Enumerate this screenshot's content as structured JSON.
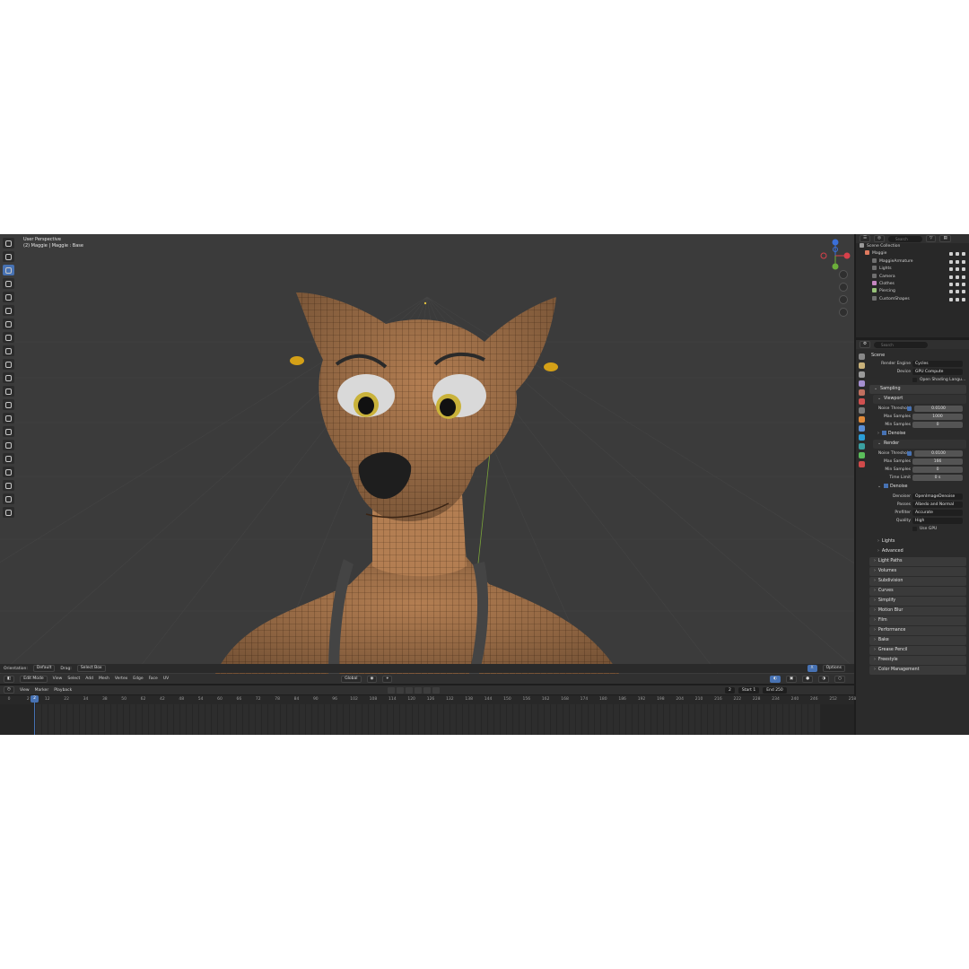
{
  "viewport": {
    "title_line1": "User Perspective",
    "title_line2": "(2) Maggie | Maggie : Base"
  },
  "header": {
    "orientation_label": "Orientation:",
    "orientation_value": "Default",
    "drag_label": "Drag:",
    "drag_value": "Select Box",
    "mode": "Edit Mode",
    "menus": [
      "View",
      "Select",
      "Add",
      "Mesh",
      "Vertex",
      "Edge",
      "Face",
      "UV"
    ],
    "transform_orientation": "Global",
    "options_label": "Options"
  },
  "timeline": {
    "menus": [
      "View",
      "Marker",
      "Playback"
    ],
    "current_frame": "2",
    "start_label": "Start",
    "start_value": "1",
    "end_label": "End",
    "end_value": "250",
    "ticks": [
      "0",
      "2",
      "12",
      "22",
      "34",
      "38",
      "50",
      "62",
      "42",
      "48",
      "54",
      "60",
      "66",
      "72",
      "78",
      "84",
      "90",
      "96",
      "102",
      "108",
      "114",
      "120",
      "126",
      "132",
      "138",
      "144",
      "150",
      "156",
      "162",
      "168",
      "174",
      "180",
      "186",
      "192",
      "198",
      "204",
      "210",
      "216",
      "222",
      "228",
      "234",
      "240",
      "246",
      "252",
      "258"
    ]
  },
  "outliner": {
    "search_placeholder": "Search",
    "items": [
      {
        "label": "Scene Collection",
        "color": "#9a9a9a"
      },
      {
        "label": "Maggie",
        "color": "#e07a5f"
      },
      {
        "label": "MaggieArmature",
        "color": "#6f6f6f"
      },
      {
        "label": "Lights",
        "color": "#6f6f6f"
      },
      {
        "label": "Camera",
        "color": "#6f6f6f"
      },
      {
        "label": "Clothes",
        "color": "#c586c0"
      },
      {
        "label": "Piercing",
        "color": "#98c379"
      },
      {
        "label": "CustomShapes",
        "color": "#6f6f6f"
      }
    ]
  },
  "properties": {
    "search_placeholder": "Search",
    "scene_label": "Scene",
    "render_engine_label": "Render Engine",
    "render_engine_value": "Cycles",
    "device_label": "Device",
    "device_value": "GPU Compute",
    "osl_label": "Open Shading Langu...",
    "sampling": "Sampling",
    "viewport": "Viewport",
    "vp_noise_label": "Noise Threshold",
    "vp_noise_value": "0.0100",
    "vp_max_label": "Max Samples",
    "vp_max_value": "1000",
    "vp_min_label": "Min Samples",
    "vp_min_value": "0",
    "vp_denoise": "Denoise",
    "render": "Render",
    "r_noise_label": "Noise Threshold",
    "r_noise_value": "0.0100",
    "r_max_label": "Max Samples",
    "r_max_value": "166",
    "r_min_label": "Min Samples",
    "r_min_value": "0",
    "r_time_label": "Time Limit",
    "r_time_value": "0 s",
    "r_denoise": "Denoise",
    "denoiser_label": "Denoiser",
    "denoiser_value": "OpenImageDenoise",
    "passes_label": "Passes",
    "passes_value": "Albedo and Normal",
    "prefilter_label": "Prefilter",
    "prefilter_value": "Accurate",
    "quality_label": "Quality",
    "quality_value": "High",
    "use_gpu": "Use GPU",
    "lights": "Lights",
    "advanced": "Advanced",
    "panels": [
      "Light Paths",
      "Volumes",
      "Subdivision",
      "Curves",
      "Simplify",
      "Motion Blur",
      "Film",
      "Performance",
      "Bake",
      "Grease Pencil",
      "Freestyle",
      "Color Management"
    ]
  },
  "colors": {
    "accent": "#4772b3",
    "viewport_bg": "#3b3b3b",
    "fur": "#b37e52",
    "mesh_wire": "#5a3a20"
  }
}
